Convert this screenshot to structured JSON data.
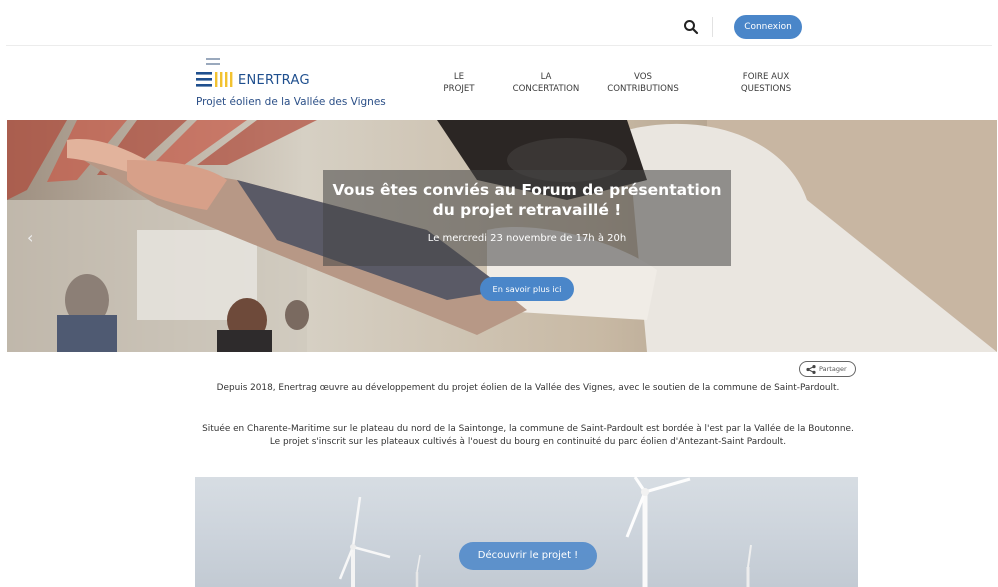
{
  "topbar": {
    "search_icon": "search-icon",
    "login_label": "Connexion"
  },
  "brand": {
    "logo_text": "ENERTRAG",
    "tagline": "Projet éolien de la Vallée des Vignes",
    "colors": {
      "primary": "#4a86c9",
      "logo_blue": "#1f4f8e",
      "logo_yellow": "#f2c230"
    }
  },
  "nav": [
    {
      "label": "LE\nPROJET"
    },
    {
      "label": "LA\nCONCERTATION"
    },
    {
      "label": "VOS\nCONTRIBUTIONS"
    },
    {
      "label": "FOIRE AUX\nQUESTIONS"
    }
  ],
  "hero": {
    "title": "Vous êtes conviés au Forum de présentation\ndu projet retravaillé !",
    "date": "Le mercredi 23 novembre de 17h à 20h",
    "cta_label": "En savoir plus ici",
    "prev_icon": "chevron-left-icon"
  },
  "share": {
    "label": "Partager",
    "icon": "share-icon"
  },
  "intro": {
    "p1": "Depuis 2018, Enertrag œuvre au développement du projet éolien de la Vallée des Vignes, avec le soutien de la commune de Saint-Pardoult.",
    "p2": "Située en Charente-Maritime sur le plateau du nord de la Saintonge, la commune de Saint-Pardoult est bordée à l'est par la Vallée de la Boutonne. Le projet s'inscrit sur les plateaux cultivés à l'ouest du bourg en continuité du parc éolien d'Antezant-Saint Pardoult."
  },
  "discover": {
    "cta_label": "Découvrir le projet !"
  }
}
